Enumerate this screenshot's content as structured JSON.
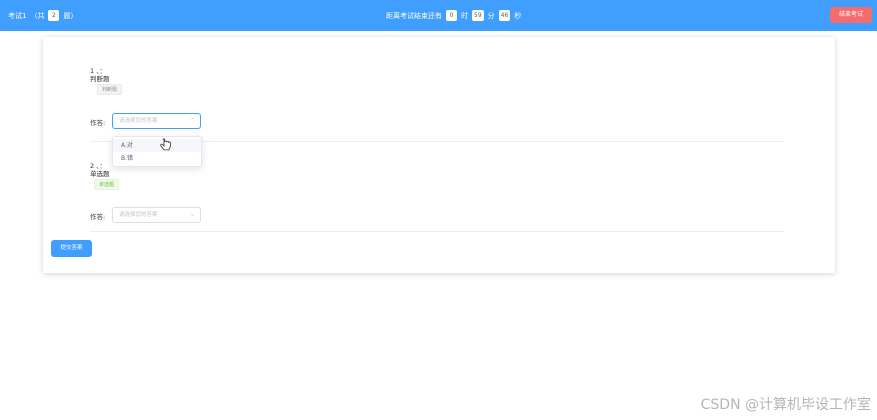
{
  "header": {
    "exam_title": "考试1",
    "count_prefix": "（共",
    "question_count": "2",
    "count_suffix": "题）",
    "timer_prefix": "距离考试结束还有",
    "hours": "0",
    "hours_unit": "时",
    "minutes": "59",
    "minutes_unit": "分",
    "seconds": "46",
    "seconds_unit": "秒",
    "end_button": "结束考试"
  },
  "questions": [
    {
      "number": "1 、：",
      "type_text": "判断题",
      "tag": "判断题",
      "answer_label": "作答:",
      "placeholder": "请选择您的答案"
    },
    {
      "number": "2 、：",
      "type_text": "单选题",
      "tag": "单选题",
      "answer_label": "作答:",
      "placeholder": "请选择您的答案"
    }
  ],
  "dropdown": {
    "options": [
      "A.对",
      "B.错"
    ]
  },
  "submit_button": "提交答案",
  "watermark": "CSDN @计算机毕设工作室",
  "colors": {
    "primary": "#409eff",
    "danger": "#f56c6c",
    "success": "#67c23a"
  }
}
